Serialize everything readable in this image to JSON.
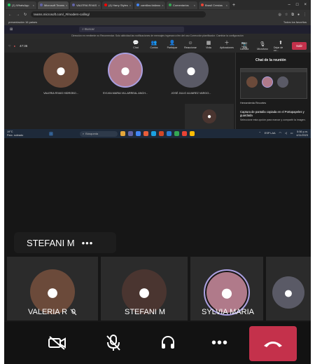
{
  "browser": {
    "tabs": [
      {
        "label": "(1) WhatsApp",
        "color": "#25d366"
      },
      {
        "label": "Microsoft Teams",
        "color": "#6264a7",
        "active": true
      },
      {
        "label": "VALERIA RIVAS",
        "color": "#6264a7"
      },
      {
        "label": "(4) Harry Styles",
        "color": "#ff0000"
      },
      {
        "label": "camillas italiano",
        "color": "#4285f4"
      },
      {
        "label": "Comentarios",
        "color": "#34a853"
      },
      {
        "label": "Brasil Crestas",
        "color": "#ea4335"
      }
    ],
    "url": "teams.microsoft.com/_#/modern-calling/",
    "bookmark_left": "presentación 16 paises",
    "bookmark_right": "Todos los favoritos"
  },
  "teams": {
    "search_placeholder": "Buscar",
    "notice": "Dirección en remitente no Recomendar. Solo aktividad las notificaciones de mensajes ingresan a fen del uso Corrección planificador. Cambiar la configuración",
    "timer": "47:36",
    "tools": [
      {
        "label": "Chat",
        "icon": "chat-icon",
        "glyph": "💬"
      },
      {
        "label": "Contos",
        "icon": "people-icon",
        "glyph": "👥"
      },
      {
        "label": "Participar",
        "icon": "participants-icon",
        "glyph": "👤"
      },
      {
        "label": "Reaccionar",
        "icon": "react-icon",
        "glyph": "☺"
      },
      {
        "label": "Vista",
        "icon": "view-icon",
        "glyph": "▦"
      },
      {
        "label": "Aplicaciones",
        "icon": "apps-icon",
        "glyph": "＋"
      },
      {
        "label": "Más",
        "icon": "more-icon",
        "glyph": "···"
      }
    ],
    "right_tools": [
      {
        "label": "Cámara",
        "icon": "camera-icon",
        "glyph": "📷"
      },
      {
        "label": "Micrófono",
        "icon": "mic-icon",
        "glyph": "🎙"
      },
      {
        "label": "Dejar de co...",
        "icon": "share-icon",
        "glyph": "⬆"
      }
    ],
    "leave_label": "Salir",
    "participants": [
      {
        "name": "VALERIA RIVAS HIDROBO...",
        "color": "#6b4a3a"
      },
      {
        "name": "SYLVIA MARIA VILLARREAL ANCH...",
        "color": "#b07a8a"
      },
      {
        "name": "JOSÉ JULIO ALVAREZ VARGO...",
        "color": "#5a5a66"
      }
    ],
    "chat_title": "Chat de la reunión",
    "snip_label": "Herramienta Recortes",
    "clip_title": "Captura de pantalla copiada en el Portapapeles y guardada",
    "clip_sub": "Seleccione esta opción para marcar y compartir la imagen."
  },
  "taskbar": {
    "weather_temp": "19°C",
    "weather_desc": "Parc. soleado",
    "search_placeholder": "Búsqueda",
    "lang": "ESP LAA",
    "time": "5:56 p.m.",
    "date": "4/11/2023"
  },
  "call": {
    "active_speaker": "STEFANI M",
    "more_glyph": "•••",
    "tiles": [
      {
        "name": "VALERIA R",
        "muted": true,
        "color": "#6b4a3a",
        "ring": false
      },
      {
        "name": "STEFANI M",
        "muted": false,
        "color": "#4a3530",
        "ring": false
      },
      {
        "name": "SYLVIA MARIA",
        "muted": false,
        "color": "#b07a8a",
        "ring": true
      },
      {
        "name": "",
        "muted": false,
        "color": "#5a5a66",
        "ring": false
      }
    ],
    "buttons": [
      {
        "icon": "camera-off-icon",
        "glyph": "📷"
      },
      {
        "icon": "mic-off-icon",
        "glyph": "🎙"
      },
      {
        "icon": "headset-icon",
        "glyph": "🎧"
      },
      {
        "icon": "more-icon",
        "glyph": "•••"
      },
      {
        "icon": "hang-up-icon",
        "glyph": "☎"
      }
    ]
  }
}
